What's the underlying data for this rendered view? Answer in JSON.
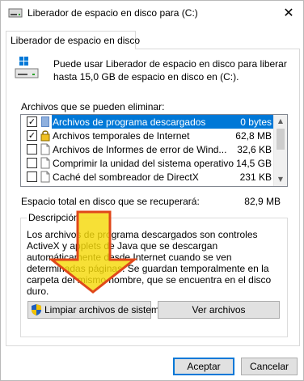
{
  "window": {
    "title": "Liberador de espacio en disco para  (C:)",
    "close_glyph": "✕"
  },
  "tab": {
    "label": "Liberador de espacio en disco"
  },
  "intro": {
    "text": "Puede usar Liberador de espacio en disco para liberar hasta 15,0 GB de espacio en disco en  (C:)."
  },
  "files": {
    "label": "Archivos que se pueden eliminar:",
    "items": [
      {
        "label": "Archivos de programa descargados",
        "size": "0 bytes",
        "checked": true,
        "selected": true,
        "icon": "folder-icon"
      },
      {
        "label": "Archivos temporales de Internet",
        "size": "62,8 MB",
        "checked": true,
        "selected": false,
        "icon": "lock-icon"
      },
      {
        "label": "Archivos de Informes de error de Wind...",
        "size": "32,6 KB",
        "checked": false,
        "selected": false,
        "icon": "file-icon"
      },
      {
        "label": "Comprimir la unidad del sistema operativo",
        "size": "14,5 GB",
        "checked": false,
        "selected": false,
        "icon": "file-icon"
      },
      {
        "label": "Caché del sombreador de DirectX",
        "size": "231 KB",
        "checked": false,
        "selected": false,
        "icon": "file-icon"
      }
    ]
  },
  "total": {
    "label": "Espacio total en disco que se recuperará:",
    "value": "82,9 MB"
  },
  "description": {
    "title": "Descripción",
    "text": "Los archivos de programa descargados son controles ActiveX y applets de Java que se descargan automáticamente desde Internet cuando se ven determinadas páginas. Se guardan temporalmente en la carpeta del mismo nombre, que se encuentra en el disco duro."
  },
  "buttons": {
    "cleanup": "Limpiar archivos de sistema",
    "view": "Ver archivos",
    "ok": "Aceptar",
    "cancel": "Cancelar"
  },
  "colors": {
    "selection": "#0078d7",
    "arrow_fill": "#f5d90a",
    "arrow_stroke": "#e0481a"
  }
}
